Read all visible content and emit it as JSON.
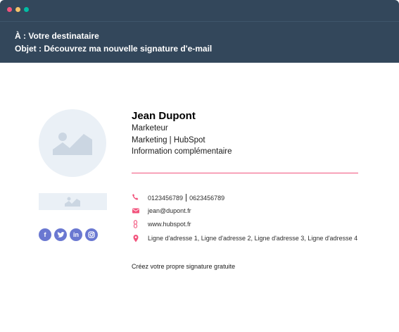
{
  "window": {
    "controls": [
      "close-dot",
      "minimize-dot",
      "maximize-dot"
    ],
    "titlebar_color": "#33475b"
  },
  "email": {
    "to_line": "À : Votre destinataire",
    "subject_line": "Objet : Découvrez ma nouvelle signature d'e-mail"
  },
  "signature": {
    "name": "Jean Dupont",
    "job_title": "Marketeur",
    "department_company": "Marketing | HubSpot",
    "extra_info": "Information complémentaire",
    "divider_color": "#f2547d",
    "contacts": {
      "phone_office": "0123456789",
      "phone_mobile": "0623456789",
      "email": "jean@dupont.fr",
      "website": "www.hubspot.fr",
      "address": "Ligne d'adresse 1, Ligne d'adresse 2, Ligne d'adresse 3, Ligne d'adresse 4"
    },
    "contact_icons": [
      "phone-icon",
      "mail-icon",
      "link-icon",
      "location-pin-icon"
    ],
    "contact_icon_color": "#f2547d",
    "social_icons": [
      "facebook-icon",
      "twitter-icon",
      "linkedin-icon",
      "instagram-icon"
    ],
    "social_color": "#6a78d1",
    "social_glyphs": {
      "facebook": "f",
      "linkedin": "in"
    },
    "placeholder_images": [
      "profile-photo-placeholder",
      "banner-image-placeholder"
    ],
    "cta": "Créez votre propre signature gratuite"
  }
}
